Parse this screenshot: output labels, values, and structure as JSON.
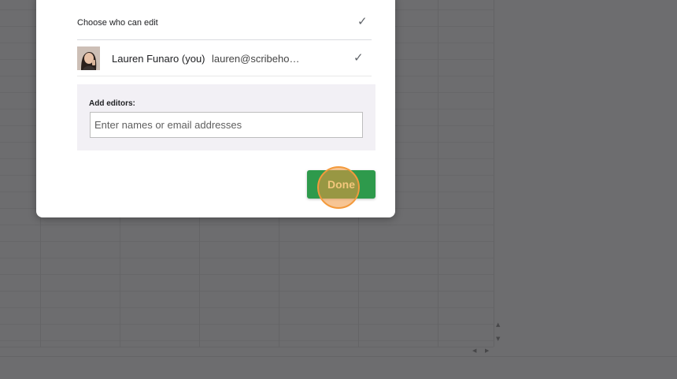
{
  "dialog": {
    "choose_label": "Choose who can edit",
    "user": {
      "name": "Lauren Funaro (you)",
      "email": "lauren@scribeho…"
    },
    "add_editors": {
      "label": "Add editors:",
      "placeholder": "Enter names or email addresses"
    },
    "done_label": "Done"
  },
  "icons": {
    "check": "checkmark-icon",
    "scroll_up": "arrow-up-icon",
    "scroll_down": "arrow-down-icon",
    "scroll_left": "arrow-left-icon",
    "scroll_right": "arrow-right-icon"
  },
  "colors": {
    "done_button": "#2e9a4c",
    "click_highlight": "#f39a3c",
    "overlay": "#444446"
  }
}
